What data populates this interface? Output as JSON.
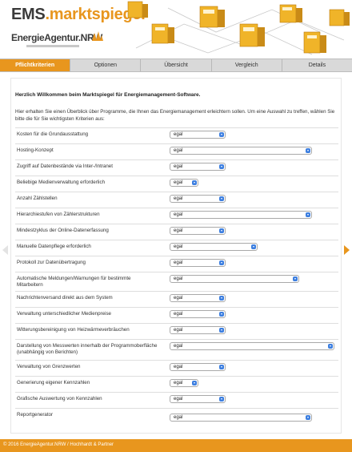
{
  "header": {
    "logo_ems_prefix": "EMS",
    "logo_ems_accent": ".marktspiegel",
    "logo_agency": "EnergieAgentur.NRW"
  },
  "tabs": [
    {
      "label": "Pflichtkriterien",
      "active": true
    },
    {
      "label": "Optionen",
      "active": false
    },
    {
      "label": "Übersicht",
      "active": false
    },
    {
      "label": "Vergleich",
      "active": false
    },
    {
      "label": "Details",
      "active": false
    }
  ],
  "intro": {
    "title": "Herzlich Willkommen beim Marktspiegel für Energiemanagement-Software.",
    "text": "Hier erhalten Sie einen Überblick über Programme, die Ihnen das Energiemanagement erleichtern sollen. Um eine Auswahl zu treffen, wählen Sie bitte die für Sie wichtigsten Kriterien aus:"
  },
  "criteria": [
    {
      "label": "Kosten für die Grundausstattung",
      "value": "egal"
    },
    {
      "label": "Hosting-Konzept",
      "value": "egal"
    },
    {
      "label": "Zugriff auf Datenbestände via Inter-/Intranet",
      "value": "egal"
    },
    {
      "label": "Beliebige Medienverwaltung erforderlich",
      "value": "egal"
    },
    {
      "label": "Anzahl Zählstellen",
      "value": "egal"
    },
    {
      "label": "Hierarchiestufen von Zählerstrukturen",
      "value": "egal"
    },
    {
      "label": "Mindestzyklus der Online-Datenerfassung",
      "value": "egal"
    },
    {
      "label": "Manuelle Datenpflege erforderlich",
      "value": "egal"
    },
    {
      "label": "Protokoll zur Datenübertragung",
      "value": "egal"
    },
    {
      "label": "Automatische Meldungen/Warnungen für bestimmte Mitarbeitern",
      "value": "egal"
    },
    {
      "label": "Nachrichtenversand direkt aus dem System",
      "value": "egal"
    },
    {
      "label": "Verwaltung unterschiedlicher Medienpreise",
      "value": "egal"
    },
    {
      "label": "Witterungsbereinigung von Heizwärmeverbräuchen",
      "value": "egal"
    },
    {
      "label": "Darstellung von Messwerten innerhalb der Programmoberfläche (unabhängig von Berichten)",
      "value": "egal"
    },
    {
      "label": "Verwaltung von Grenzwerten",
      "value": "egal"
    },
    {
      "label": "Generierung eigener Kennzahlen",
      "value": "egal"
    },
    {
      "label": "Grafische Auswertung von Kennzahlen",
      "value": "egal"
    },
    {
      "label": "Reportgenerator",
      "value": "egal"
    }
  ],
  "footer": {
    "copyright": "© 2016 EnergieAgentur.NRW / Hochhardt & Partner"
  },
  "colors": {
    "accent": "#e8961e",
    "tab_bar": "#d9d9d9",
    "select_arrow": "#3d7fe0"
  }
}
